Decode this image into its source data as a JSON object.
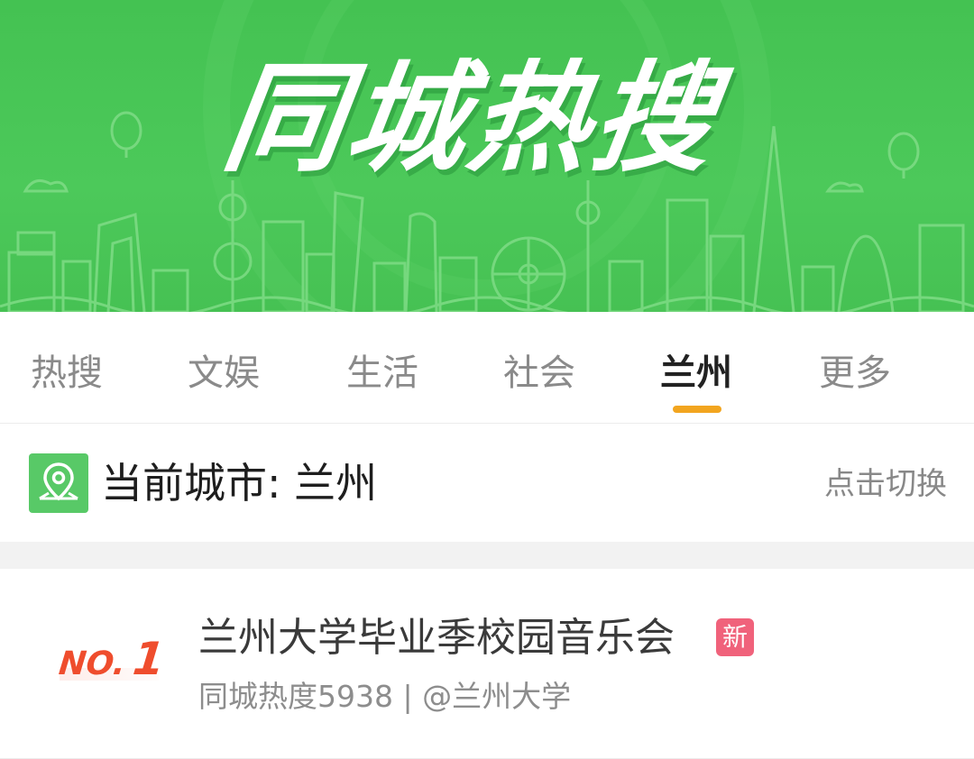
{
  "banner": {
    "title": "同城热搜"
  },
  "tabs": [
    {
      "label": "热搜",
      "active": false
    },
    {
      "label": "文娱",
      "active": false
    },
    {
      "label": "生活",
      "active": false
    },
    {
      "label": "社会",
      "active": false
    },
    {
      "label": "兰州",
      "active": true
    },
    {
      "label": "更多",
      "active": false
    }
  ],
  "city": {
    "label": "当前城市: 兰州",
    "switch_label": "点击切换",
    "icon": "location-pin-icon"
  },
  "hot_list": [
    {
      "rank_prefix": "NO.",
      "rank": "1",
      "title": "兰州大学毕业季校园音乐会",
      "badge": "新",
      "meta": "同城热度5938 | @兰州大学"
    }
  ],
  "colors": {
    "brand_green": "#4cc95a",
    "tab_indicator": "#f2a51f",
    "rank_red": "#ef4d2d",
    "new_badge": "#f0627b"
  }
}
